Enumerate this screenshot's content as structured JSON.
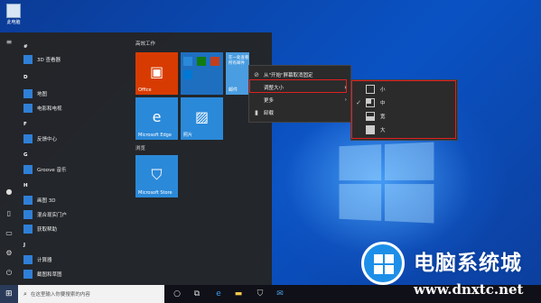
{
  "desktop": {
    "icon_label": "此电脑"
  },
  "start_menu": {
    "app_list": [
      {
        "label": "#",
        "letter": true
      },
      {
        "label": "3D 查看器"
      },
      {
        "label": "D",
        "letter": true
      },
      {
        "label": "地图"
      },
      {
        "label": "电影和电视"
      },
      {
        "label": "F",
        "letter": true
      },
      {
        "label": "反馈中心"
      },
      {
        "label": "G",
        "letter": true
      },
      {
        "label": "Groove 音乐"
      },
      {
        "label": "H",
        "letter": true
      },
      {
        "label": "画图 3D"
      },
      {
        "label": "混合现实门户"
      },
      {
        "label": "获取帮助"
      },
      {
        "label": "J",
        "letter": true
      },
      {
        "label": "计算器"
      },
      {
        "label": "截图和草图"
      }
    ],
    "groups": {
      "create": "高效工作",
      "browse": "浏览"
    },
    "tiles": {
      "office": "Office",
      "edge": "Microsoft Edge",
      "photos": "照片",
      "store": "Microsoft Store",
      "wide_text": "在一处查看所有邮件",
      "wide_label": "邮件"
    }
  },
  "context_menu": {
    "items": [
      {
        "label": "从\"开始\"屏幕取消固定",
        "icon": "unpin-icon"
      },
      {
        "label": "调整大小",
        "icon": ""
      },
      {
        "label": "更多",
        "icon": ""
      },
      {
        "label": "卸载",
        "icon": "trash-icon"
      }
    ]
  },
  "resize_submenu": {
    "items": [
      {
        "label": "小",
        "checked": false
      },
      {
        "label": "中",
        "checked": true
      },
      {
        "label": "宽",
        "checked": false
      },
      {
        "label": "大",
        "checked": false
      }
    ]
  },
  "taskbar": {
    "search_placeholder": "在这里输入你要搜索的内容"
  },
  "watermark": {
    "name": "电脑系统城",
    "url": "www.dnxtc.net"
  },
  "colors": {
    "tile_blue": "#2b89d9",
    "office_red": "#d83b01",
    "highlight_red": "#e02020"
  }
}
